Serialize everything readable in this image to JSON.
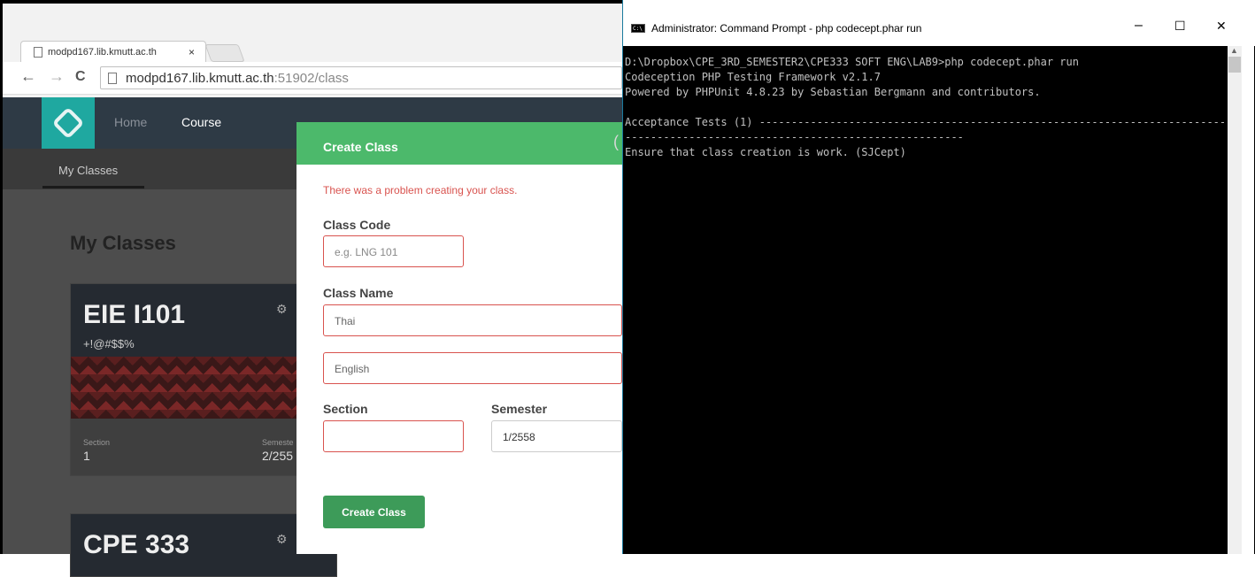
{
  "browser": {
    "tab_title": "modpd167.lib.kmutt.ac.th",
    "tab_close": "×",
    "back": "←",
    "forward": "→",
    "reload": "C",
    "url_host": "modpd167.lib.kmutt.ac.th",
    "url_path": ":51902/class"
  },
  "app": {
    "nav": {
      "home": "Home",
      "course": "Course"
    },
    "subnav": {
      "my_classes": "My Classes"
    },
    "page_title": "My Classes",
    "cards": [
      {
        "code": "EIE I101",
        "name": "+!@#$$%",
        "gear": "⚙",
        "section_label": "Section",
        "section": "1",
        "semester_label": "Semeste",
        "semester": "2/255"
      },
      {
        "code": "CPE 333",
        "gear": "⚙"
      }
    ]
  },
  "modal": {
    "title": "Create Class",
    "corner": "(",
    "error": "There was a problem creating your class.",
    "class_code_label": "Class Code",
    "class_code_placeholder": "e.g. LNG 101",
    "class_name_label": "Class Name",
    "class_name_thai": "Thai",
    "class_name_english": "English",
    "section_label": "Section",
    "section_value": "",
    "semester_label": "Semester",
    "semester_value": "1/2558",
    "submit": "Create Class"
  },
  "cmd": {
    "icon_text": "C:\\",
    "title": "Administrator: Command Prompt - php  codecept.phar run",
    "minimize": "–",
    "maximize": "☐",
    "close": "✕",
    "scroll_up": "▲",
    "output": "D:\\Dropbox\\CPE_3RD_SEMESTER2\\CPE333 SOFT ENG\\LAB9>php codecept.phar run\nCodeception PHP Testing Framework v2.1.7\nPowered by PHPUnit 4.8.23 by Sebastian Bergmann and contributors.\n\nAcceptance Tests (1) ---------------------------------------------------------------------------\n-----------------------------------------------------\nEnsure that class creation is work. (SJCept)"
  }
}
